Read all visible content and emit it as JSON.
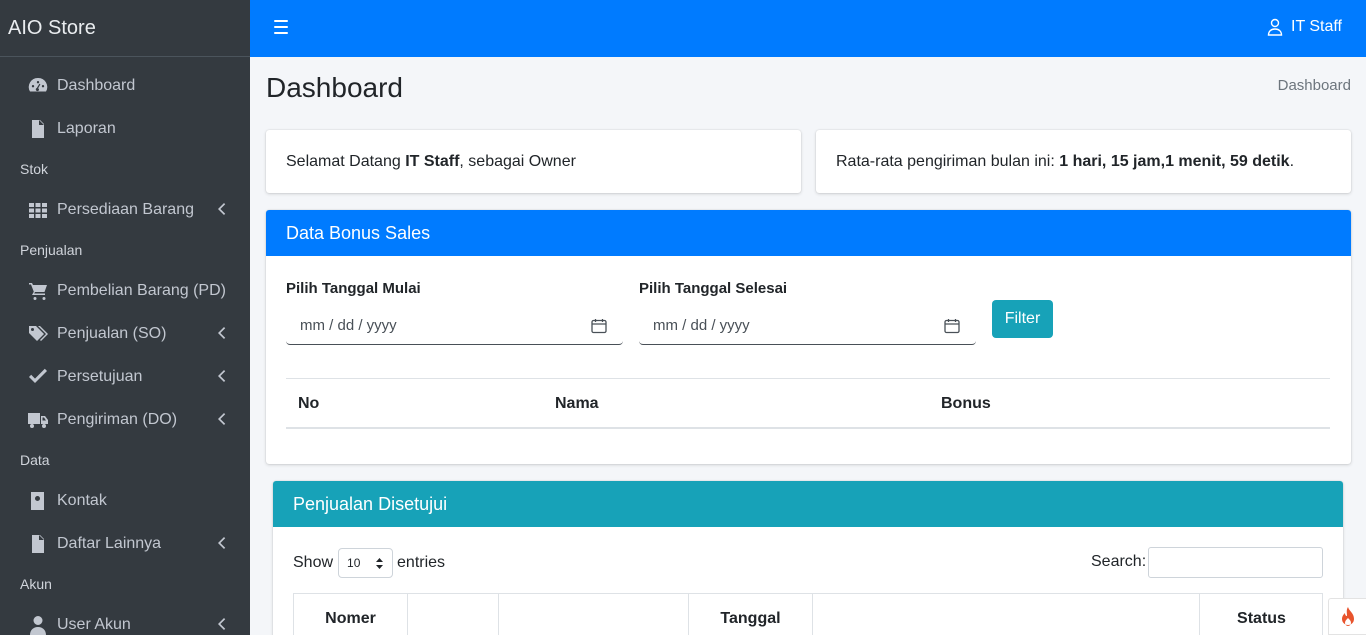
{
  "brand": "AIO Store",
  "topbar": {
    "user_label": "IT Staff"
  },
  "sidebar": {
    "items": [
      {
        "label": "Dashboard"
      },
      {
        "label": "Laporan"
      },
      {
        "header": "Stok"
      },
      {
        "label": "Persediaan Barang"
      },
      {
        "header": "Penjualan"
      },
      {
        "label": "Pembelian Barang (PD)"
      },
      {
        "label": "Penjualan (SO)"
      },
      {
        "label": "Persetujuan"
      },
      {
        "label": "Pengiriman (DO)"
      },
      {
        "header": "Data"
      },
      {
        "label": "Kontak"
      },
      {
        "label": "Daftar Lainnya"
      },
      {
        "header": "Akun"
      },
      {
        "label": "User Akun"
      }
    ]
  },
  "page": {
    "title": "Dashboard",
    "breadcrumb": "Dashboard"
  },
  "welcome": {
    "prefix": "Selamat Datang ",
    "name": "IT Staff",
    "suffix": ", sebagai Owner"
  },
  "avg_delivery": {
    "prefix": "Rata-rata pengiriman bulan ini: ",
    "value": "1 hari, 15 jam,1 menit, 59 detik",
    "suffix": "."
  },
  "bonus": {
    "title": "Data Bonus Sales",
    "start_label": "Pilih Tanggal Mulai",
    "end_label": "Pilih Tanggal Selesai",
    "date_placeholder": "mm / dd / yyyy",
    "filter_label": "Filter",
    "columns": [
      "No",
      "Nama",
      "Bonus"
    ]
  },
  "approved": {
    "title": "Penjualan Disetujui",
    "show_label": "Show",
    "entries_value": "10",
    "entries_label": "entries",
    "search_label": "Search:",
    "columns": [
      "Nomer",
      "",
      "",
      "Tanggal",
      "",
      "Status"
    ]
  }
}
